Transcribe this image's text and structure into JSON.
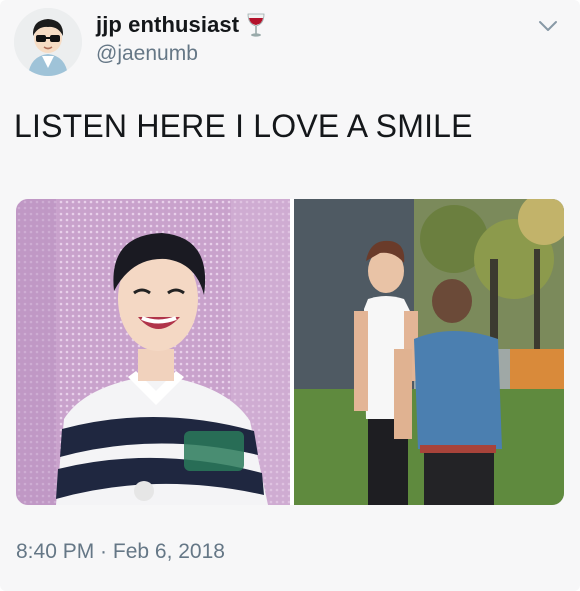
{
  "tweet": {
    "display_name": "jjp enthusiast",
    "name_emoji": "wine-glass-icon",
    "handle": "@jaenumb",
    "text": "LISTEN HERE I LOVE A SMILE",
    "timestamp": "8:40 PM · Feb 6, 2018",
    "menu_icon": "chevron-down-icon"
  },
  "media": {
    "photos": [
      {
        "description_icon": "photo-smiling-man-striped-sweater"
      },
      {
        "description_icon": "photo-two-people-outdoors"
      }
    ]
  },
  "colors": {
    "text": "#14171a",
    "secondary": "#657786",
    "background": "#f7f7f8"
  }
}
